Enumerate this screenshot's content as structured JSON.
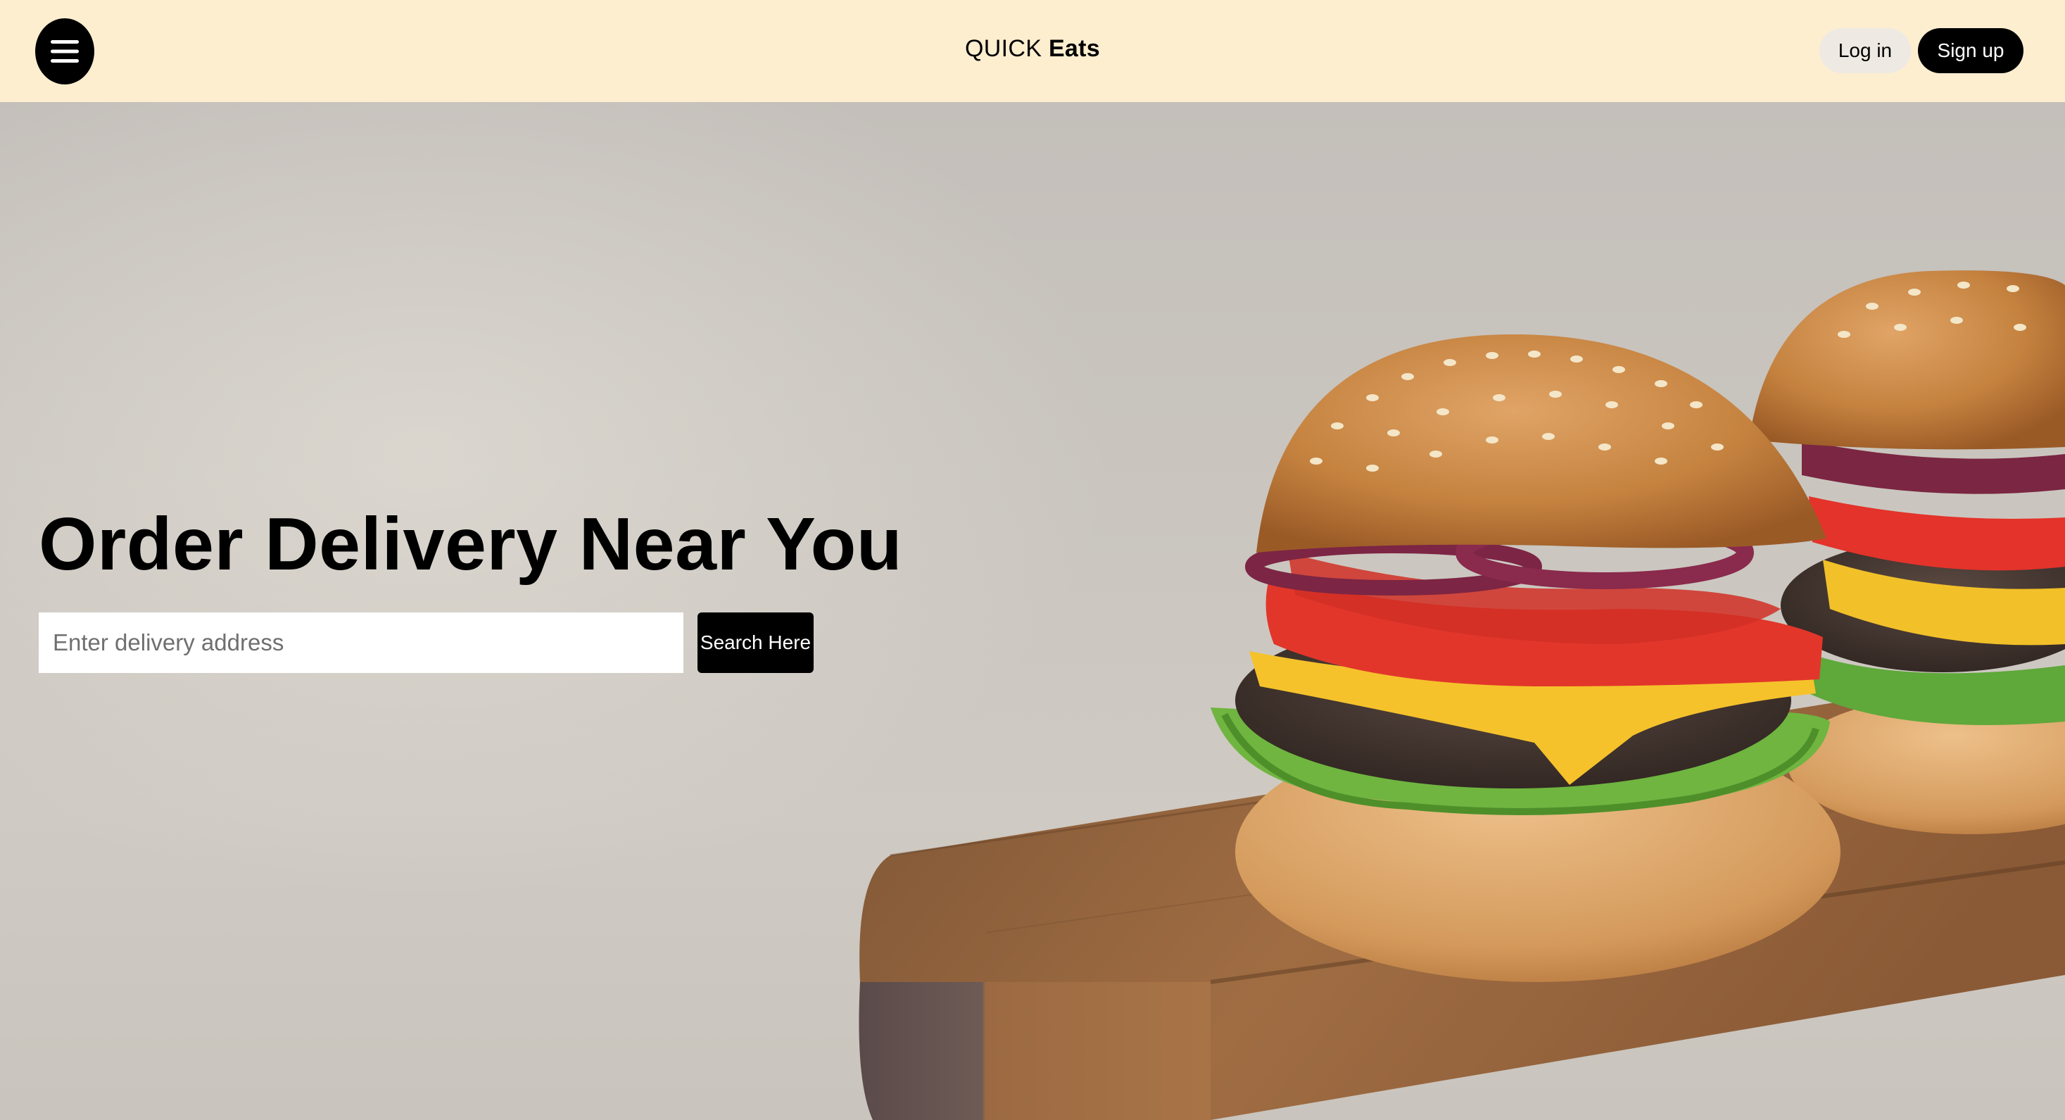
{
  "header": {
    "menu_icon": "hamburger-menu-icon",
    "brand_part1": "QUICK",
    "brand_part2": "Eats",
    "login_label": "Log in",
    "signup_label": "Sign up",
    "background_color": "#fdeed0"
  },
  "hero": {
    "title": "Order Delivery Near You",
    "address_placeholder": "Enter delivery address",
    "address_value": "",
    "search_label": "Search Here",
    "image_subject": "burgers-on-wooden-board"
  }
}
